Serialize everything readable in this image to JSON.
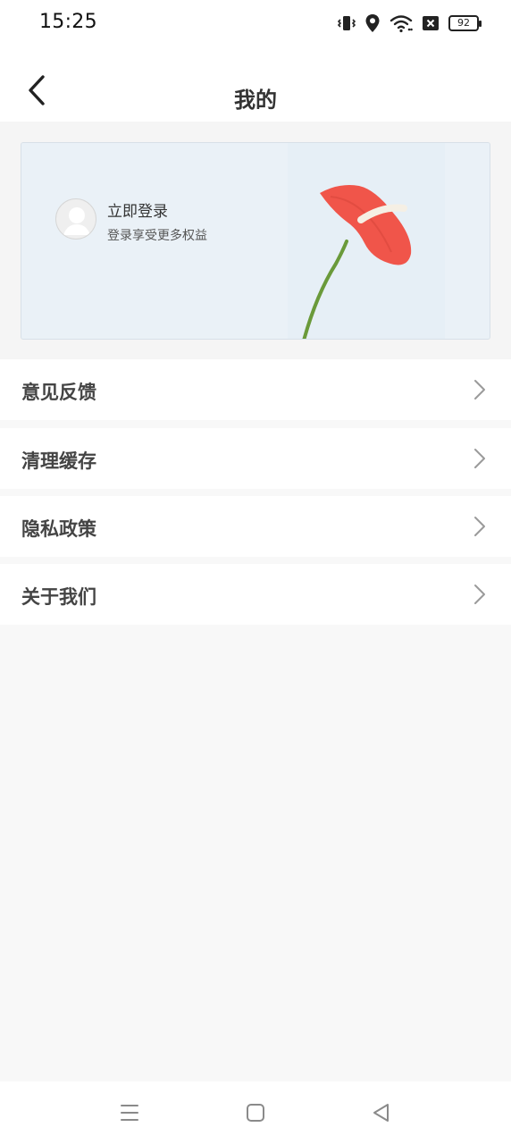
{
  "status_bar": {
    "time": "15:25",
    "battery_level": "92",
    "icons": [
      "vibrate-icon",
      "location-icon",
      "wifi-icon",
      "sim-off-icon",
      "battery-icon"
    ]
  },
  "header": {
    "title": "我的",
    "back_icon": "chevron-left-icon"
  },
  "profile_card": {
    "login_title": "立即登录",
    "login_subtitle": "登录享受更多权益",
    "avatar_icon": "default-avatar-icon"
  },
  "menu": {
    "items": [
      {
        "label": "意见反馈",
        "icon": "chevron-right-icon"
      },
      {
        "label": "清理缓存",
        "icon": "chevron-right-icon"
      },
      {
        "label": "隐私政策",
        "icon": "chevron-right-icon"
      },
      {
        "label": "关于我们",
        "icon": "chevron-right-icon"
      }
    ]
  },
  "nav_bar": {
    "buttons": [
      "menu-icon",
      "home-icon",
      "back-triangle-icon"
    ]
  },
  "colors": {
    "background": "#f8f8f8",
    "card_background": "#eaf1f7",
    "flower": "#f0554a",
    "text_primary": "#444444"
  }
}
